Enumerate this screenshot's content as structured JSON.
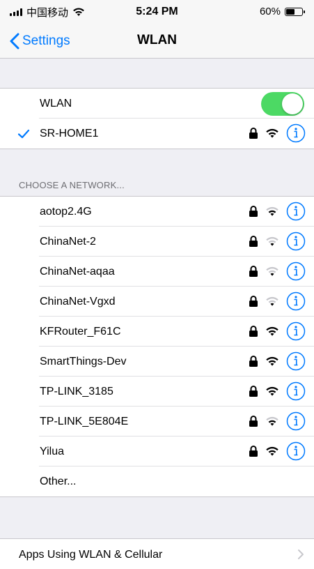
{
  "status_bar": {
    "carrier": "中国移动",
    "time": "5:24 PM",
    "battery": "60%",
    "battery_level": 0.6
  },
  "nav": {
    "back_label": "Settings",
    "title": "WLAN"
  },
  "wlan_toggle": {
    "label": "WLAN",
    "on": true
  },
  "connected": {
    "name": "SR-HOME1",
    "locked": true,
    "wifi_strength": "full"
  },
  "choose_header": "CHOOSE A NETWORK...",
  "networks": [
    {
      "name": "aotop2.4G",
      "locked": true,
      "wifi_strength": "medium"
    },
    {
      "name": "ChinaNet-2",
      "locked": true,
      "wifi_strength": "low"
    },
    {
      "name": "ChinaNet-aqaa",
      "locked": true,
      "wifi_strength": "low"
    },
    {
      "name": "ChinaNet-Vgxd",
      "locked": true,
      "wifi_strength": "low"
    },
    {
      "name": "KFRouter_F61C",
      "locked": true,
      "wifi_strength": "full"
    },
    {
      "name": "SmartThings-Dev",
      "locked": true,
      "wifi_strength": "full"
    },
    {
      "name": "TP-LINK_3185",
      "locked": true,
      "wifi_strength": "full"
    },
    {
      "name": "TP-LINK_5E804E",
      "locked": true,
      "wifi_strength": "medium"
    },
    {
      "name": "Yilua",
      "locked": true,
      "wifi_strength": "full"
    }
  ],
  "other_label": "Other...",
  "apps_row": {
    "label": "Apps Using WLAN & Cellular"
  },
  "colors": {
    "accent": "#007aff",
    "toggle_on": "#4cd964",
    "background": "#efeff4"
  }
}
